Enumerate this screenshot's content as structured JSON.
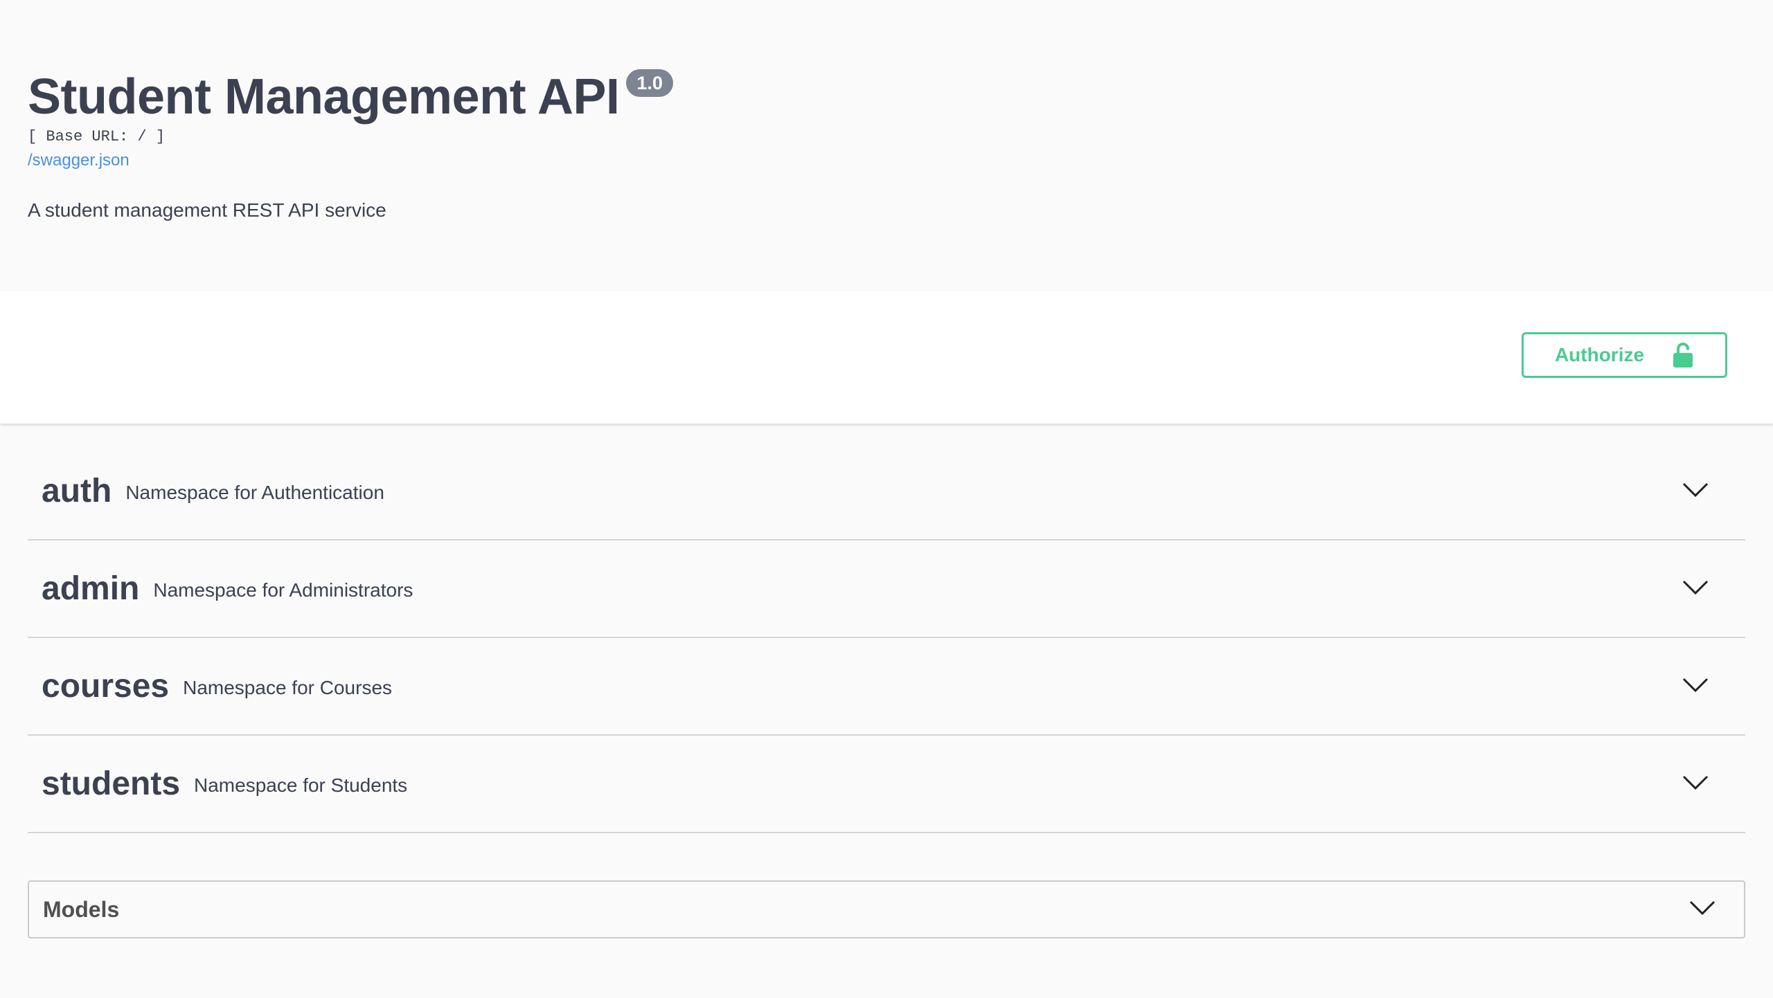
{
  "info": {
    "title": "Student Management API",
    "version": "1.0",
    "base_url": "[ Base URL: / ]",
    "spec_link": "/swagger.json",
    "description": "A student management REST API service"
  },
  "scheme": {
    "authorize_label": "Authorize",
    "authorize_icon": "unlocked-lock-icon",
    "accent_color": "#49cc90"
  },
  "tags": [
    {
      "name": "auth",
      "description": "Namespace for Authentication",
      "icon": "chevron-down-icon"
    },
    {
      "name": "admin",
      "description": "Namespace for Administrators",
      "icon": "chevron-down-icon"
    },
    {
      "name": "courses",
      "description": "Namespace for Courses",
      "icon": "chevron-down-icon"
    },
    {
      "name": "students",
      "description": "Namespace for Students",
      "icon": "chevron-down-icon"
    }
  ],
  "models": {
    "title": "Models",
    "icon": "chevron-down-icon"
  },
  "colors": {
    "text": "#3b4151",
    "link": "#4990e2",
    "version_badge": "#7d8492",
    "authorize": "#49cc90"
  }
}
